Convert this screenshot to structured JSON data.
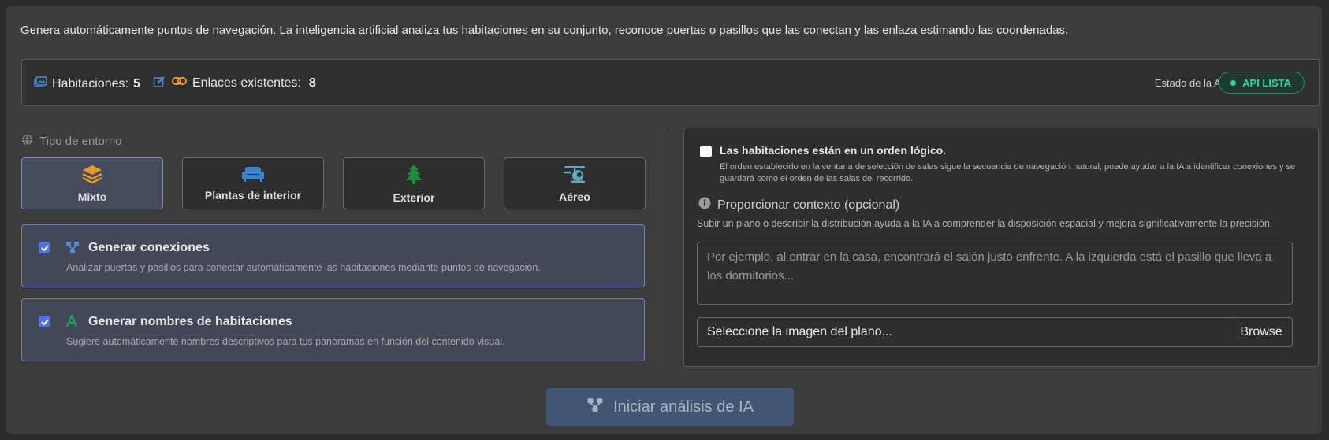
{
  "intro_text": "Genera automáticamente puntos de navegación. La inteligencia artificial analiza tus habitaciones en su conjunto, reconoce puertas o pasillos que las conectan y las enlaza estimando las coordenadas.",
  "stats": {
    "rooms_label": "Habitaciones:",
    "rooms_count": "5",
    "links_label": "Enlaces existentes:",
    "links_count": "8",
    "api_label": "Estado de la API",
    "api_status": "API LISTA"
  },
  "environment": {
    "title": "Tipo de entorno",
    "options": [
      {
        "label": "Mixto",
        "icon": "layers-icon",
        "active": true
      },
      {
        "label": "Plantas de interior",
        "icon": "sofa-icon",
        "active": false
      },
      {
        "label": "Exterior",
        "icon": "tree-icon",
        "active": false
      },
      {
        "label": "Aéreo",
        "icon": "helicopter-icon",
        "active": false
      }
    ]
  },
  "options": {
    "connections": {
      "title": "Generar conexiones",
      "description": "Analizar puertas y pasillos para conectar automáticamente las habitaciones mediante puntos de navegación.",
      "checked": true
    },
    "names": {
      "title": "Generar nombres de habitaciones",
      "description": "Sugiere automáticamente nombres descriptivos para tus panoramas en función del contenido visual.",
      "checked": true
    }
  },
  "right": {
    "order_title": "Las habitaciones están en un orden lógico.",
    "order_desc": "El orden establecido en la ventana de selección de salas sigue la secuencia de navegación natural, puede ayudar a la IA a identificar conexiones y se guardará como el orden de las salas del recorrido.",
    "order_checked": false,
    "context_title": "Proporcionar contexto (opcional)",
    "context_desc": "Subir un plano o describir la distribución ayuda a la IA a comprender la disposición espacial y mejora significativamente la precisión.",
    "context_placeholder": "Por ejemplo, al entrar en la casa, encontrará el salón justo enfrente. A la izquierda está el pasillo que lleva a los dormitorios...",
    "file_placeholder": "Seleccione la imagen del plano...",
    "browse_label": "Browse"
  },
  "start_button": "Iniciar análisis de IA",
  "colors": {
    "accent_blue": "#4e73e0",
    "api_green": "#38d39a",
    "link_orange": "#e39a2b",
    "tree_green": "#1e8e3e"
  }
}
